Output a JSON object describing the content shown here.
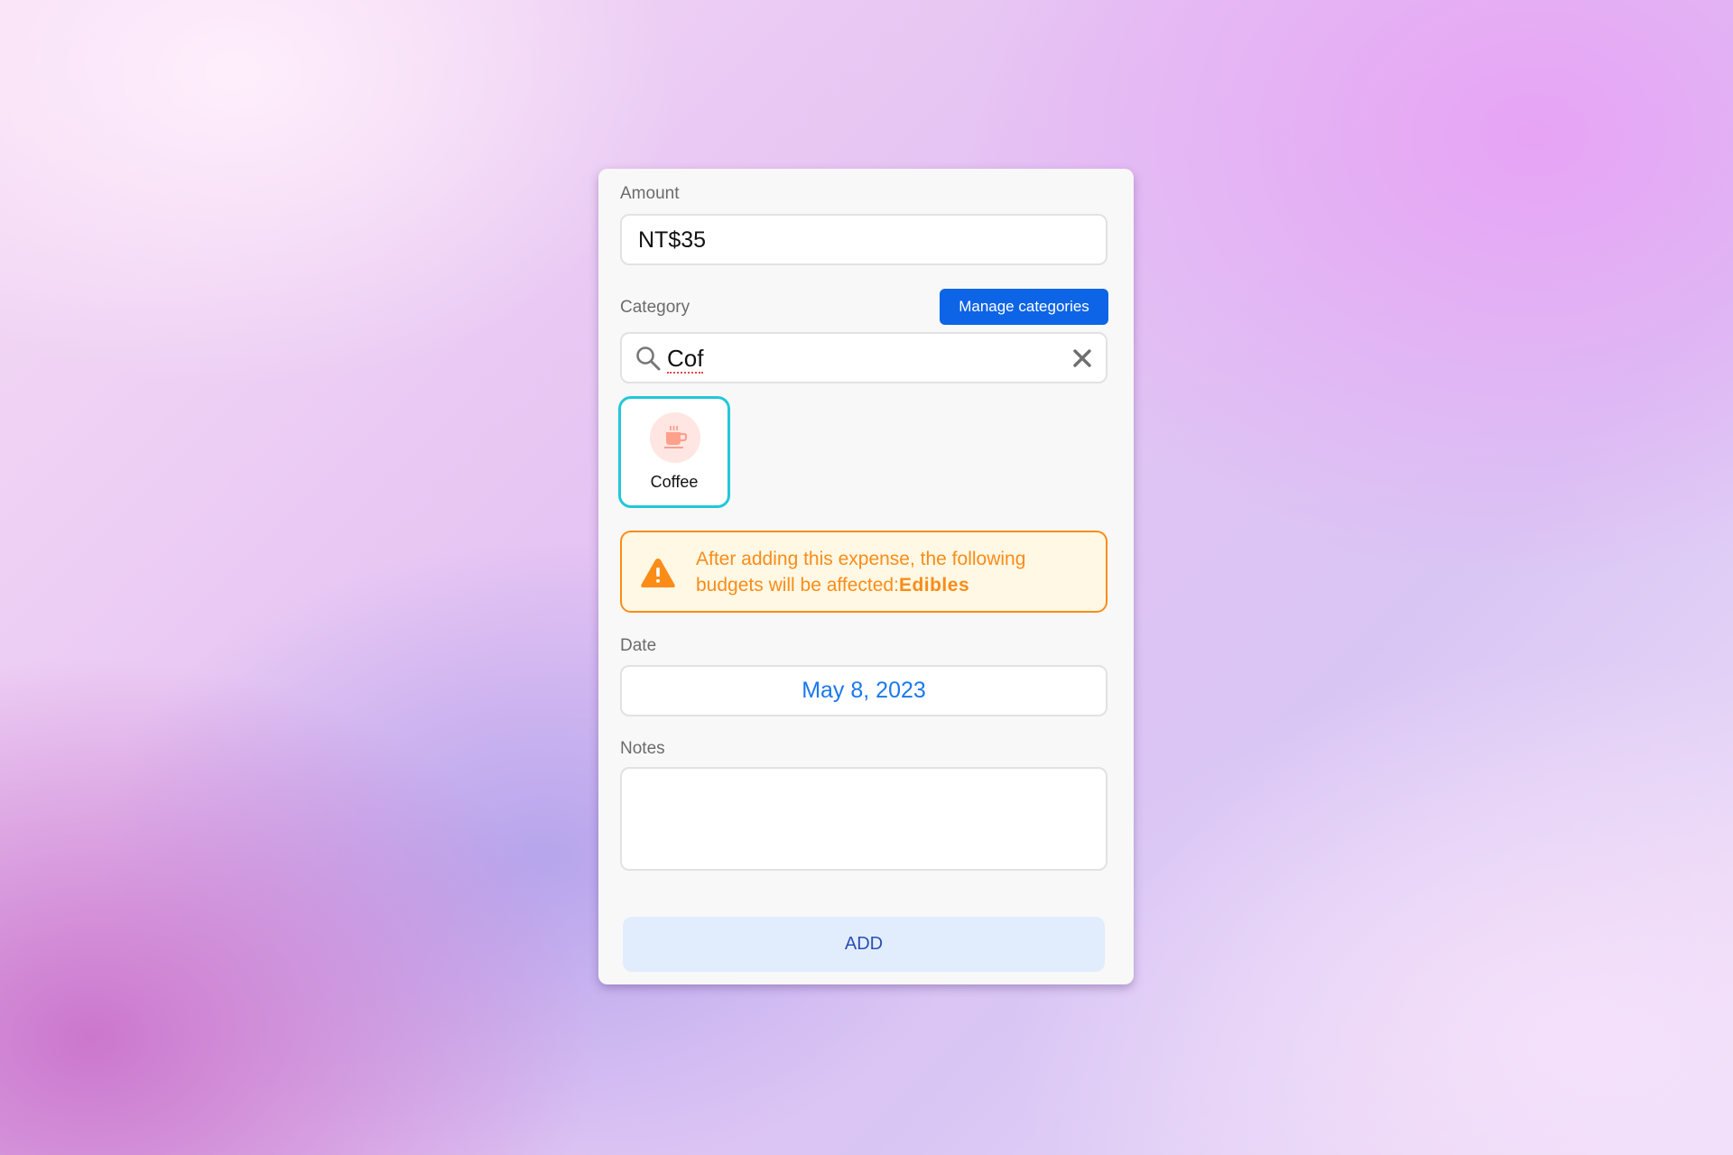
{
  "form": {
    "amount": {
      "label": "Amount",
      "value": "NT$35"
    },
    "category": {
      "label": "Category",
      "manage_button": "Manage categories",
      "search_value": "Cof",
      "search_icon": "search-icon",
      "clear_icon": "close-icon",
      "results": [
        {
          "name": "Coffee",
          "icon": "coffee-cup-icon",
          "selected": true,
          "icon_color": "#fda08c",
          "icon_bg": "#ffe6e2"
        }
      ]
    },
    "warning": {
      "icon": "warning-triangle-icon",
      "text": "After adding this expense, the following budgets will be affected:",
      "budget": "Edibles"
    },
    "date": {
      "label": "Date",
      "value": "May 8, 2023"
    },
    "notes": {
      "label": "Notes",
      "value": ""
    },
    "submit_label": "ADD"
  },
  "colors": {
    "primary": "#0d64e6",
    "selected_border": "#21c8d8",
    "warning": "#fb8c18",
    "warning_bg": "#fff8e4",
    "date_text": "#1a78ec",
    "add_bg": "#e1edfd"
  }
}
